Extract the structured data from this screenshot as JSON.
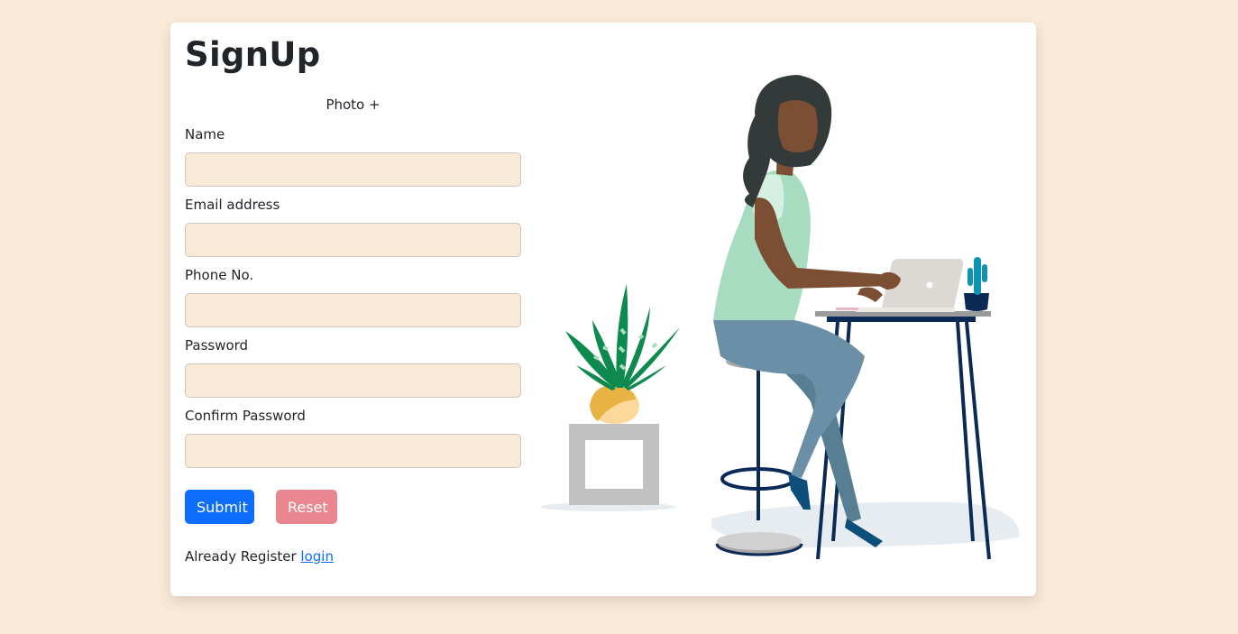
{
  "page": {
    "title": "SignUp",
    "photo_label": "Photo +"
  },
  "form": {
    "fields": [
      {
        "label": "Name",
        "value": "",
        "placeholder": ""
      },
      {
        "label": "Email address",
        "value": "",
        "placeholder": ""
      },
      {
        "label": "Phone No.",
        "value": "",
        "placeholder": ""
      },
      {
        "label": "Password",
        "value": "",
        "placeholder": ""
      },
      {
        "label": "Confirm Password",
        "value": "",
        "placeholder": ""
      }
    ],
    "submit_label": "Submit",
    "reset_label": "Reset"
  },
  "footer": {
    "text": "Already Register",
    "link_label": "login"
  },
  "colors": {
    "background": "#fae9d7",
    "submit": "#0d6efd",
    "reset": "#ea868f",
    "link": "#0d6efd"
  },
  "illustration": {
    "icon": "woman-at-laptop-illustration"
  }
}
